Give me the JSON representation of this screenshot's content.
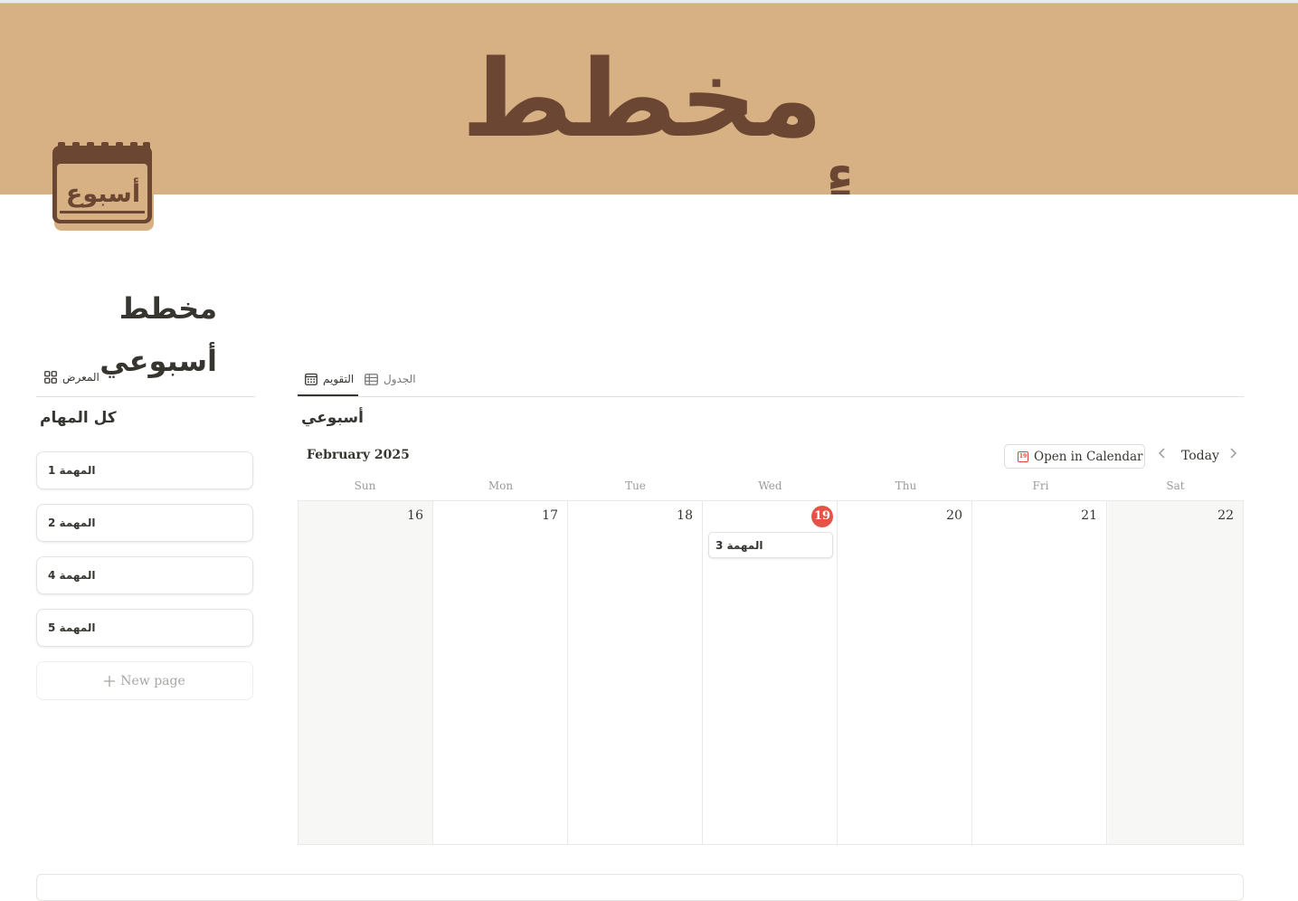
{
  "cover": {
    "text": "مخطط أسبوعي",
    "color": "#d7b083",
    "text_color": "#6b4733"
  },
  "page_icon": {
    "name": "calendar-icon",
    "text": "أسبوع"
  },
  "page": {
    "title": "مخطط أسبوعي"
  },
  "left_panel": {
    "view_tab": {
      "label": "المعرض",
      "icon": "gallery-icon"
    },
    "section_title": "كل المهام",
    "cards": [
      {
        "label": "المهمة 1"
      },
      {
        "label": "المهمة 2"
      },
      {
        "label": "المهمة 4"
      },
      {
        "label": "المهمة 5"
      }
    ],
    "new_page": {
      "label": "New page",
      "icon": "plus-icon"
    }
  },
  "calendar": {
    "tabs": [
      {
        "label": "التقويم",
        "icon": "calendar-icon",
        "active": true
      },
      {
        "label": "الجدول",
        "icon": "table-icon",
        "active": false
      }
    ],
    "title": "أسبوعي",
    "month": "February 2025",
    "open_in_calendar": {
      "label": "Open in Calendar",
      "icon_text": "19"
    },
    "today_label": "Today",
    "days_of_week": [
      "Sun",
      "Mon",
      "Tue",
      "Wed",
      "Thu",
      "Fri",
      "Sat"
    ],
    "dates": [
      "16",
      "17",
      "18",
      "19",
      "20",
      "21",
      "22"
    ],
    "today_date": "19",
    "events": [
      {
        "day": "19",
        "label": "المهمة 3"
      }
    ],
    "accent": "#e55347"
  }
}
